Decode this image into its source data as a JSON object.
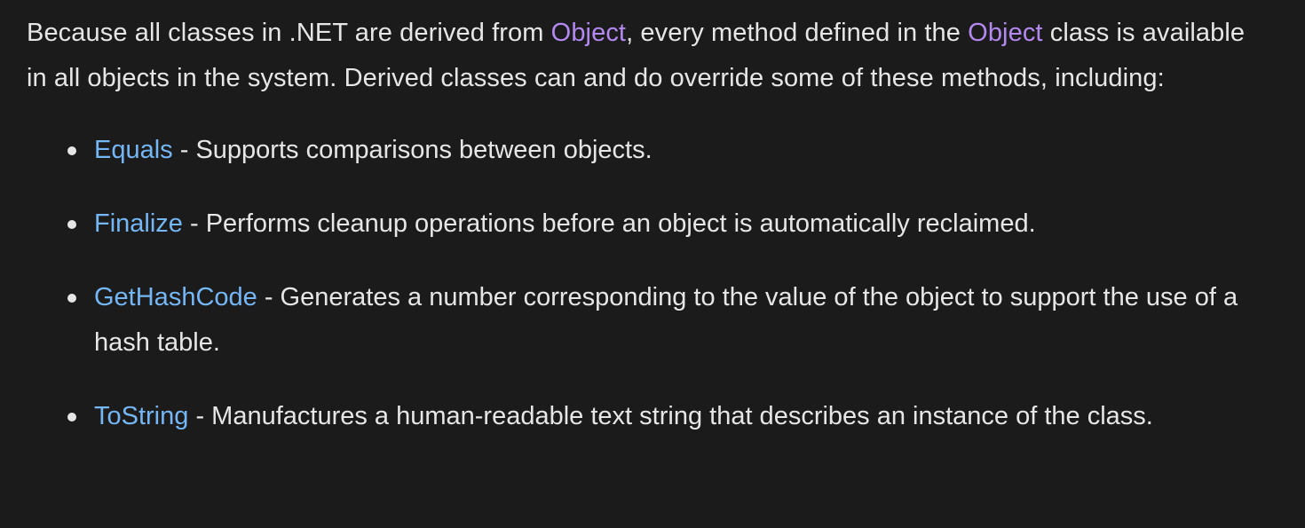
{
  "intro": {
    "part1": "Because all classes in .NET are derived from ",
    "link1": "Object",
    "part2": ", every method defined in the ",
    "link2": "Object",
    "part3": " class is available in all objects in the system. Derived classes can and do override some of these methods, including:"
  },
  "methods": [
    {
      "name": "Equals",
      "desc": " - Supports comparisons between objects."
    },
    {
      "name": "Finalize",
      "desc": " - Performs cleanup operations before an object is automatically reclaimed."
    },
    {
      "name": "GetHashCode",
      "desc": " - Generates a number corresponding to the value of the object to support the use of a hash table."
    },
    {
      "name": "ToString",
      "desc": " - Manufactures a human-readable text string that describes an instance of the class."
    }
  ],
  "colors": {
    "background": "#1b1b1b",
    "text": "#e6e6e6",
    "object_link": "#b389f0",
    "method_link": "#75b6f5"
  }
}
